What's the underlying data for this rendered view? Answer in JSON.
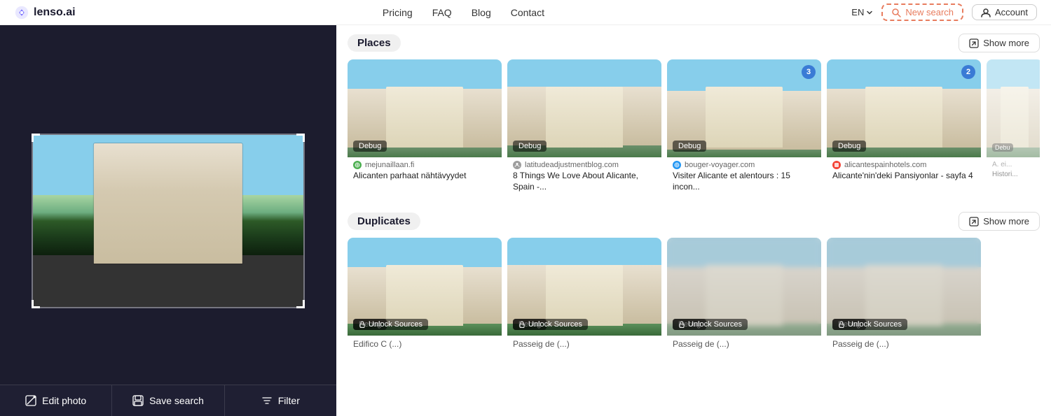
{
  "header": {
    "logo_text": "lenso.ai",
    "nav": [
      {
        "label": "Pricing",
        "active": false
      },
      {
        "label": "FAQ",
        "active": false
      },
      {
        "label": "Blog",
        "active": false
      },
      {
        "label": "Contact",
        "active": false
      }
    ],
    "lang": "EN",
    "new_search_label": "New search",
    "account_label": "Account"
  },
  "left_panel": {
    "edit_photo_label": "Edit photo",
    "save_search_label": "Save search",
    "filter_label": "Filter"
  },
  "places_section": {
    "title": "Places",
    "show_more_label": "Show more",
    "cards": [
      {
        "source_icon": "circle-fi",
        "source_name": "mejunaillaan.fi",
        "title": "Alicanten parhaat nähtävyydet",
        "debug": true,
        "count": null,
        "blur": false
      },
      {
        "source_icon": "circle-blog",
        "source_name": "latitudeadjustmentblog.com",
        "title": "8 Things We Love About Alicante, Spain -...",
        "debug": true,
        "count": null,
        "blur": false
      },
      {
        "source_icon": "circle-bouger",
        "source_name": "bouger-voyager.com",
        "title": "Visiter Alicante et alentours : 15 incon...",
        "debug": true,
        "count": 3,
        "blur": false
      },
      {
        "source_icon": "circle-alicante",
        "source_name": "alicantespainhotels.com",
        "title": "Alicante'nin'deki Pansiyonlar - sayfa 4",
        "debug": true,
        "count": 2,
        "blur": false
      },
      {
        "source_icon": "circle-partial",
        "source_name": "A. ei...",
        "title": "Histori...",
        "debug": true,
        "count": null,
        "blur": false,
        "partial": true
      }
    ]
  },
  "duplicates_section": {
    "title": "Duplicates",
    "show_more_label": "Show more",
    "cards": [
      {
        "source_name": "Unlock Sources",
        "subtitle": "Edifico C (...)",
        "debug": true,
        "blur": false
      },
      {
        "source_name": "Unlock Sources",
        "subtitle": "Passeig de (...)",
        "debug": true,
        "blur": false
      },
      {
        "source_name": "Unlock Sources",
        "subtitle": "Passeig de (...)",
        "debug": true,
        "blur": true
      },
      {
        "source_name": "Unlock Sources",
        "subtitle": "Passeig de (...)",
        "debug": true,
        "blur": true
      }
    ]
  }
}
